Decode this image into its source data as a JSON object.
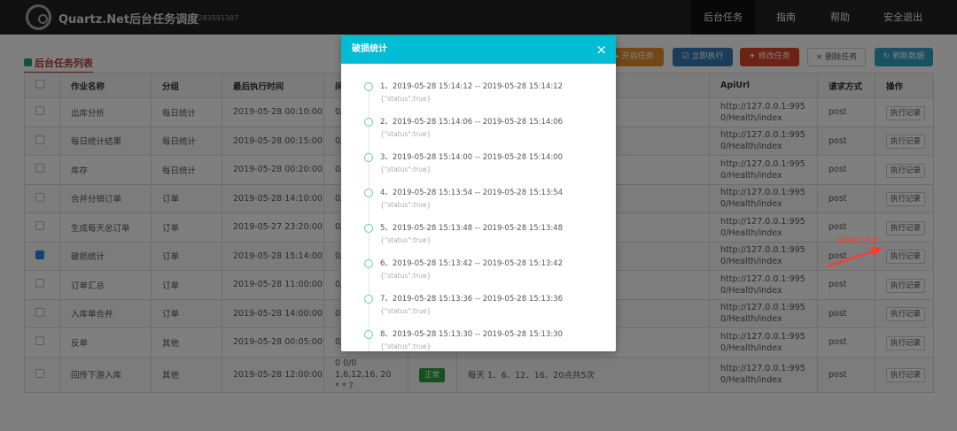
{
  "nav": {
    "brand": "Quartz.Net后台任务调度",
    "qq": "QQ : 283591387",
    "items": [
      "后台任务",
      "指南",
      "帮助",
      "安全退出"
    ]
  },
  "section_title": "后台任务列表",
  "toolbar": {
    "start": "开启任务",
    "run": "立即执行",
    "edit": "修改任务",
    "delete": "删除任务",
    "refresh": "刷新数据"
  },
  "table": {
    "headers": [
      "作业名称",
      "分组",
      "最后执行时间",
      "间",
      "",
      "",
      "ApiUrl",
      "请求方式",
      "操作"
    ],
    "rows": [
      {
        "name": "出库分析",
        "group": "每日统计",
        "last": "2019-05-28 00:10:00",
        "cron": "0/",
        "checked": false
      },
      {
        "name": "每日统计结果",
        "group": "每日统计",
        "last": "2019-05-28 00:15:00",
        "cron": "0/",
        "checked": false
      },
      {
        "name": "库存",
        "group": "每日统计",
        "last": "2019-05-28 00:20:00",
        "cron": "0/",
        "checked": false
      },
      {
        "name": "合并分销订单",
        "group": "订单",
        "last": "2019-05-28 14:10:00",
        "cron": "0/",
        "checked": false
      },
      {
        "name": "生成每天总订单",
        "group": "订单",
        "last": "2019-05-27 23:20:00",
        "cron": "0/",
        "checked": false
      },
      {
        "name": "破损统计",
        "group": "订单",
        "last": "2019-05-28 15:14:00",
        "cron": "0/",
        "checked": true
      },
      {
        "name": "订单汇总",
        "group": "订单",
        "last": "2019-05-28 11:00:00",
        "cron": "0/",
        "checked": false
      },
      {
        "name": "入库单合并",
        "group": "订单",
        "last": "2019-05-28 14:00:00",
        "cron": "0",
        "checked": false
      },
      {
        "name": "反单",
        "group": "其他",
        "last": "2019-05-28 00:05:00",
        "cron": "0/",
        "checked": false
      },
      {
        "name": "回传下游入库",
        "group": "其他",
        "last": "2019-05-28 12:00:00",
        "cron": "0 0/0 1,6,12,16, 20 * * ?",
        "status": "正常",
        "desc": "每天 1、6、12、16、20点共5次",
        "checked": false
      }
    ],
    "api_url": "http://127.0.0.1:9950/Health/index",
    "method": "post",
    "action": "执行记录"
  },
  "annotation": "查看执行记录",
  "modal": {
    "title": "破损统计",
    "close": "×",
    "records": [
      {
        "time": "1、2019-05-28 15:14:12 -- 2019-05-28 15:14:12",
        "result": "{\"status\":true}"
      },
      {
        "time": "2、2019-05-28 15:14:06 -- 2019-05-28 15:14:06",
        "result": "{\"status\":true}"
      },
      {
        "time": "3、2019-05-28 15:14:00 -- 2019-05-28 15:14:00",
        "result": "{\"status\":true}"
      },
      {
        "time": "4、2019-05-28 15:13:54 -- 2019-05-28 15:13:54",
        "result": "{\"status\":true}"
      },
      {
        "time": "5、2019-05-28 15:13:48 -- 2019-05-28 15:13:48",
        "result": "{\"status\":true}"
      },
      {
        "time": "6、2019-05-28 15:13:42 -- 2019-05-28 15:13:42",
        "result": "{\"status\":true}"
      },
      {
        "time": "7、2019-05-28 15:13:36 -- 2019-05-28 15:13:36",
        "result": "{\"status\":true}"
      },
      {
        "time": "8、2019-05-28 15:13:30 -- 2019-05-28 15:13:30",
        "result": "{\"status\":true}"
      }
    ]
  },
  "colors": {
    "nav": "#222222",
    "modal_header": "#00bcd4",
    "start": "#e8912d",
    "run": "#337ab7",
    "edit": "#d9472b",
    "refresh": "#31a2c4",
    "badge": "#2e9e3e",
    "annotation": "#ff3b30"
  }
}
